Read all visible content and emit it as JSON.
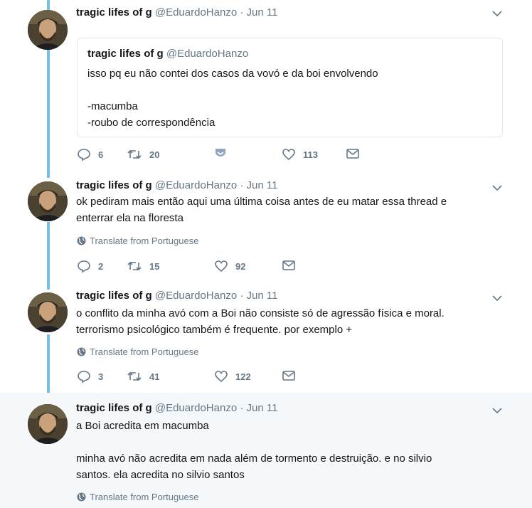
{
  "author": {
    "name": "tragic lifes of g",
    "handle": "@EduardoHanzo"
  },
  "tweets": [
    {
      "date": "Jun 11",
      "quote": {
        "name": "tragic lifes of g",
        "handle": "@EduardoHanzo",
        "line1": "isso pq eu não contei dos casos da vovó e da boi envolvendo",
        "line2": "-macumba",
        "line3": "-roubo de correspondência"
      },
      "replies": "6",
      "retweets": "20",
      "likes": "113"
    },
    {
      "date": "Jun 11",
      "text1": "ok pediram mais então aqui uma última coisa antes de eu matar essa thread e",
      "text2": "enterrar ela na floresta",
      "translate": "Translate from Portuguese",
      "replies": "2",
      "retweets": "15",
      "likes": "92"
    },
    {
      "date": "Jun 11",
      "text1": "o conflito da minha avó com a Boi não consiste só de agressão física e moral.",
      "text2": "terrorismo psicológico também é frequente. por exemplo +",
      "translate": "Translate from Portuguese",
      "replies": "3",
      "retweets": "41",
      "likes": "122"
    },
    {
      "date": "Jun 11",
      "text1": "a Boi acredita em macumba",
      "text2": "minha avó não acredita em nada além de tormento e destruição. e no silvio",
      "text3": "santos. ela acredita no silvio santos",
      "translate": "Translate from Portuguese"
    }
  ],
  "separator": "·",
  "icons": {
    "reply": "reply-icon",
    "retweet": "retweet-icon",
    "like": "heart-icon",
    "dm": "envelope-icon",
    "caret": "chevron-down-icon",
    "globe": "globe-icon",
    "bookmark": "shield-icon"
  },
  "colors": {
    "thread_line": "#76bfe3",
    "highlight_bg": "#f5f8fa",
    "muted": "#657786",
    "text": "#14171a",
    "accent_blue": "#8fa4c4"
  }
}
